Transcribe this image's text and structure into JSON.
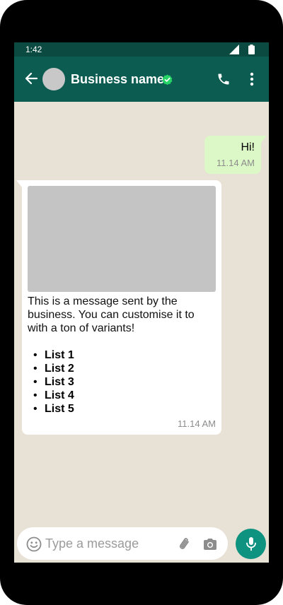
{
  "status_bar": {
    "time": "1:42"
  },
  "header": {
    "contact_name": "Business name",
    "icons": {
      "back": "arrow-back-icon",
      "verified": "verified-badge-icon",
      "call": "phone-icon",
      "more": "more-vert-icon"
    }
  },
  "messages": [
    {
      "direction": "outgoing",
      "text": "Hi!",
      "time": "11.14 AM"
    },
    {
      "direction": "incoming",
      "has_media": true,
      "text": "This is a message sent by the business. You can customise it to with a ton of variants!",
      "list": [
        "List 1",
        "List 2",
        "List 3",
        "List 4",
        "List 5"
      ],
      "time": "11.14 AM"
    }
  ],
  "composer": {
    "placeholder": "Type a message",
    "value": "",
    "icons": {
      "emoji": "emoji-icon",
      "attach": "paperclip-icon",
      "camera": "camera-icon",
      "mic": "microphone-icon"
    }
  },
  "colors": {
    "header": "#0d5c52",
    "status_bar": "#0b4a40",
    "chat_background": "#e8e1d6",
    "outgoing_bubble": "#dcf8c6",
    "incoming_bubble": "#ffffff",
    "accent": "#0d9380",
    "verified": "#25d366"
  }
}
